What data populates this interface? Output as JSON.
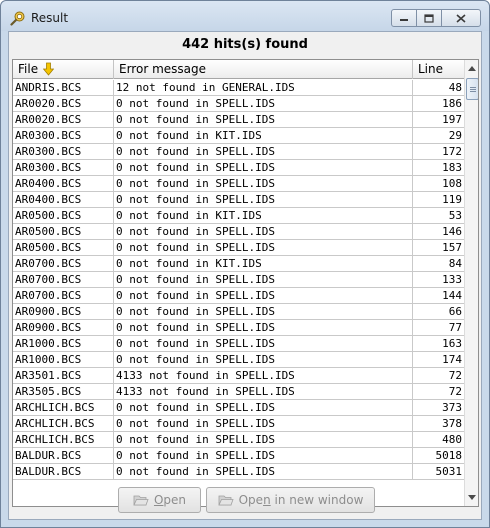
{
  "window": {
    "title": "Result",
    "icon": "search-result-icon",
    "controls": [
      "minimize-icon",
      "maximize-icon",
      "close-icon"
    ]
  },
  "hits_label": "442 hits(s) found",
  "table": {
    "columns": {
      "file": "File",
      "message": "Error message",
      "line": "Line"
    },
    "sort_column": "file",
    "rows": [
      {
        "file": "ANDRIS.BCS",
        "message": "12 not found in GENERAL.IDS",
        "line": "48"
      },
      {
        "file": "AR0020.BCS",
        "message": "0 not found in SPELL.IDS",
        "line": "186"
      },
      {
        "file": "AR0020.BCS",
        "message": "0 not found in SPELL.IDS",
        "line": "197"
      },
      {
        "file": "AR0300.BCS",
        "message": "0 not found in KIT.IDS",
        "line": "29"
      },
      {
        "file": "AR0300.BCS",
        "message": "0 not found in SPELL.IDS",
        "line": "172"
      },
      {
        "file": "AR0300.BCS",
        "message": "0 not found in SPELL.IDS",
        "line": "183"
      },
      {
        "file": "AR0400.BCS",
        "message": "0 not found in SPELL.IDS",
        "line": "108"
      },
      {
        "file": "AR0400.BCS",
        "message": "0 not found in SPELL.IDS",
        "line": "119"
      },
      {
        "file": "AR0500.BCS",
        "message": "0 not found in KIT.IDS",
        "line": "53"
      },
      {
        "file": "AR0500.BCS",
        "message": "0 not found in SPELL.IDS",
        "line": "146"
      },
      {
        "file": "AR0500.BCS",
        "message": "0 not found in SPELL.IDS",
        "line": "157"
      },
      {
        "file": "AR0700.BCS",
        "message": "0 not found in KIT.IDS",
        "line": "84"
      },
      {
        "file": "AR0700.BCS",
        "message": "0 not found in SPELL.IDS",
        "line": "133"
      },
      {
        "file": "AR0700.BCS",
        "message": "0 not found in SPELL.IDS",
        "line": "144"
      },
      {
        "file": "AR0900.BCS",
        "message": "0 not found in SPELL.IDS",
        "line": "66"
      },
      {
        "file": "AR0900.BCS",
        "message": "0 not found in SPELL.IDS",
        "line": "77"
      },
      {
        "file": "AR1000.BCS",
        "message": "0 not found in SPELL.IDS",
        "line": "163"
      },
      {
        "file": "AR1000.BCS",
        "message": "0 not found in SPELL.IDS",
        "line": "174"
      },
      {
        "file": "AR3501.BCS",
        "message": "4133 not found in SPELL.IDS",
        "line": "72"
      },
      {
        "file": "AR3505.BCS",
        "message": "4133 not found in SPELL.IDS",
        "line": "72"
      },
      {
        "file": "ARCHLICH.BCS",
        "message": "0 not found in SPELL.IDS",
        "line": "373"
      },
      {
        "file": "ARCHLICH.BCS",
        "message": "0 not found in SPELL.IDS",
        "line": "378"
      },
      {
        "file": "ARCHLICH.BCS",
        "message": "0 not found in SPELL.IDS",
        "line": "480"
      },
      {
        "file": "BALDUR.BCS",
        "message": "0 not found in SPELL.IDS",
        "line": "5018"
      },
      {
        "file": "BALDUR.BCS",
        "message": "0 not found in SPELL.IDS",
        "line": "5031"
      }
    ]
  },
  "buttons": {
    "open": {
      "prefix": "",
      "mnemonic": "O",
      "suffix": "pen",
      "enabled": false
    },
    "open_new": {
      "prefix": "Ope",
      "mnemonic": "n",
      "suffix": " in new window",
      "enabled": false
    }
  },
  "colors": {
    "frame": "#c9d9ea",
    "disabled_text": "#8d8d8d",
    "sort_arrow": "#e8b400"
  }
}
